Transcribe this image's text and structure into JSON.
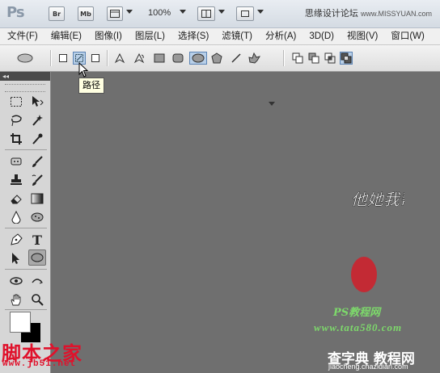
{
  "titlebar": {
    "logo": "Ps",
    "bridge": "Br",
    "minibridge": "Mb",
    "zoom": "100%",
    "site": "思缘设计论坛",
    "site_url": "www.MISSYUAN.com"
  },
  "menu": [
    "文件(F)",
    "编辑(E)",
    "图像(I)",
    "图层(L)",
    "选择(S)",
    "滤镜(T)",
    "分析(A)",
    "3D(D)",
    "视图(V)",
    "窗口(W)"
  ],
  "tooltip": "路径",
  "toolpanel": {
    "collapse": "◂◂"
  },
  "watermarks": {
    "jb51": "脚本之家",
    "jb51_url": "www.jb51.net",
    "calligraphy": "他她我帮你",
    "ps_course": "PS教程网",
    "tata_url": "www.tata580.com",
    "chazidian": "查字典 教程网",
    "chazidian_url": "jiaocheng.chazidian.com"
  }
}
